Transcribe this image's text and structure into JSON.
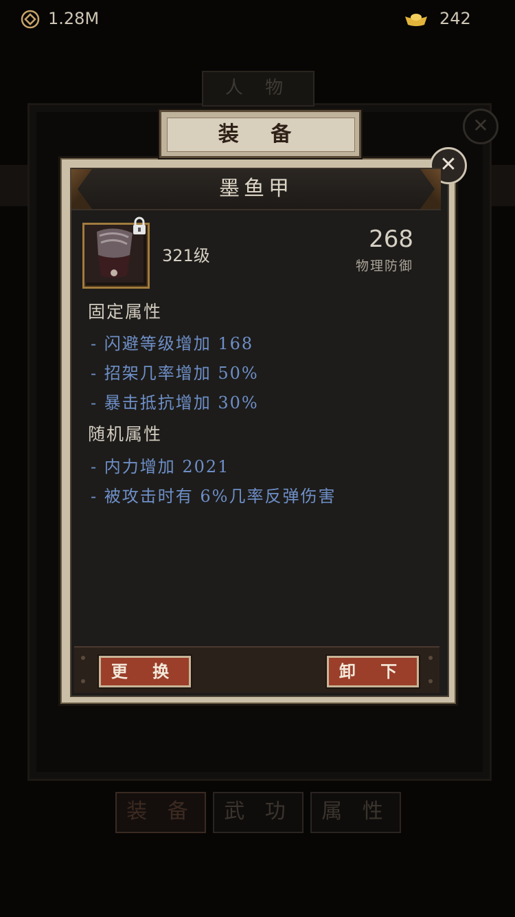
{
  "currency": {
    "coin_icon": "coin-icon",
    "coin_value": "1.28M",
    "ingot_icon": "gold-ingot-icon",
    "ingot_value": "242"
  },
  "background_panel": {
    "title": "人 物",
    "close_icon": "close-icon",
    "tabs": [
      {
        "label": "装 备",
        "active": true
      },
      {
        "label": "武 功",
        "active": false
      },
      {
        "label": "属 性",
        "active": false
      }
    ]
  },
  "dialog": {
    "tab_label": "装 备",
    "close_icon": "close-icon",
    "item": {
      "name": "墨鱼甲",
      "icon": "armor-icon",
      "locked_icon": "lock-icon",
      "level": "321级",
      "stat_value": "268",
      "stat_label": "物理防御"
    },
    "fixed_title": "固定属性",
    "fixed_attrs": [
      "- 闪避等级增加 168",
      "- 招架几率增加 50%",
      "- 暴击抵抗增加 30%"
    ],
    "random_title": "随机属性",
    "random_attrs": [
      "- 内力增加 2021",
      "- 被攻击时有 6%几率反弹伤害"
    ],
    "buttons": {
      "replace": "更 换",
      "unequip": "卸 下"
    }
  },
  "colors": {
    "attr_blue": "#6e8fc8",
    "button_red": "#9b3e2a",
    "frame_beige": "#cbbfa7"
  }
}
